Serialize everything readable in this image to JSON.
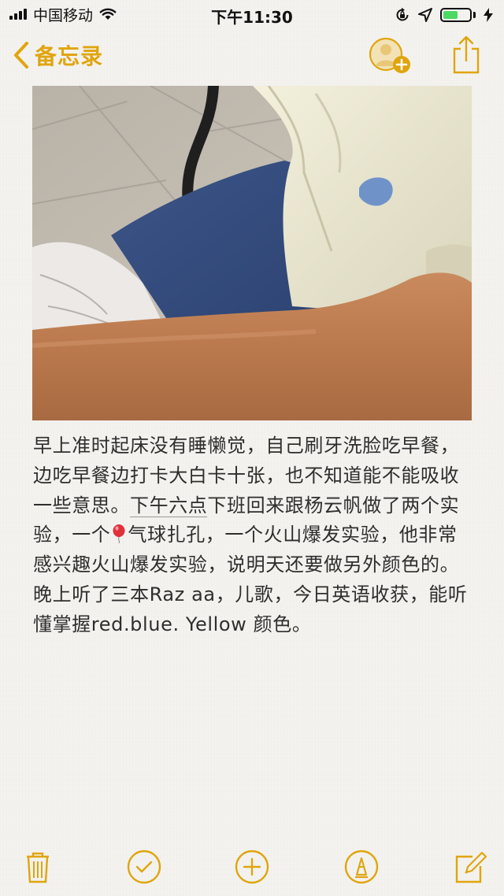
{
  "status_bar": {
    "carrier": "中国移动",
    "time": "下午11:30",
    "battery_level": 0.55,
    "icons": [
      "signal-icon",
      "wifi-icon",
      "rotation-lock-icon",
      "location-icon",
      "battery-icon",
      "charging-icon"
    ]
  },
  "nav": {
    "back_label": "备忘录",
    "accent_color": "#e0a50e",
    "icons": [
      "chevron-left-icon",
      "add-person-icon",
      "share-icon"
    ]
  },
  "photo": {
    "name": "attached-photo"
  },
  "note": {
    "text_1": "早上准时起床没有睡懒觉，自己刷牙洗脸吃早餐，边吃早餐边打卡大白卡十张，也不知道能不能吸收一些意思。",
    "text_underlined": "下午六点",
    "text_2": "下班回来跟杨云帆做了两个实验，一个",
    "text_3": "气球扎孔，一个火山爆发实验，他非常感兴趣火山爆发实验，说明天还要做另外颜色的。晚上听了三本Raz aa，儿歌，今日英语收获，能听懂掌握red.blue. Yellow 颜色。"
  },
  "toolbar": {
    "icons": [
      "trash-icon",
      "checklist-icon",
      "add-icon",
      "markup-icon",
      "compose-icon"
    ]
  }
}
